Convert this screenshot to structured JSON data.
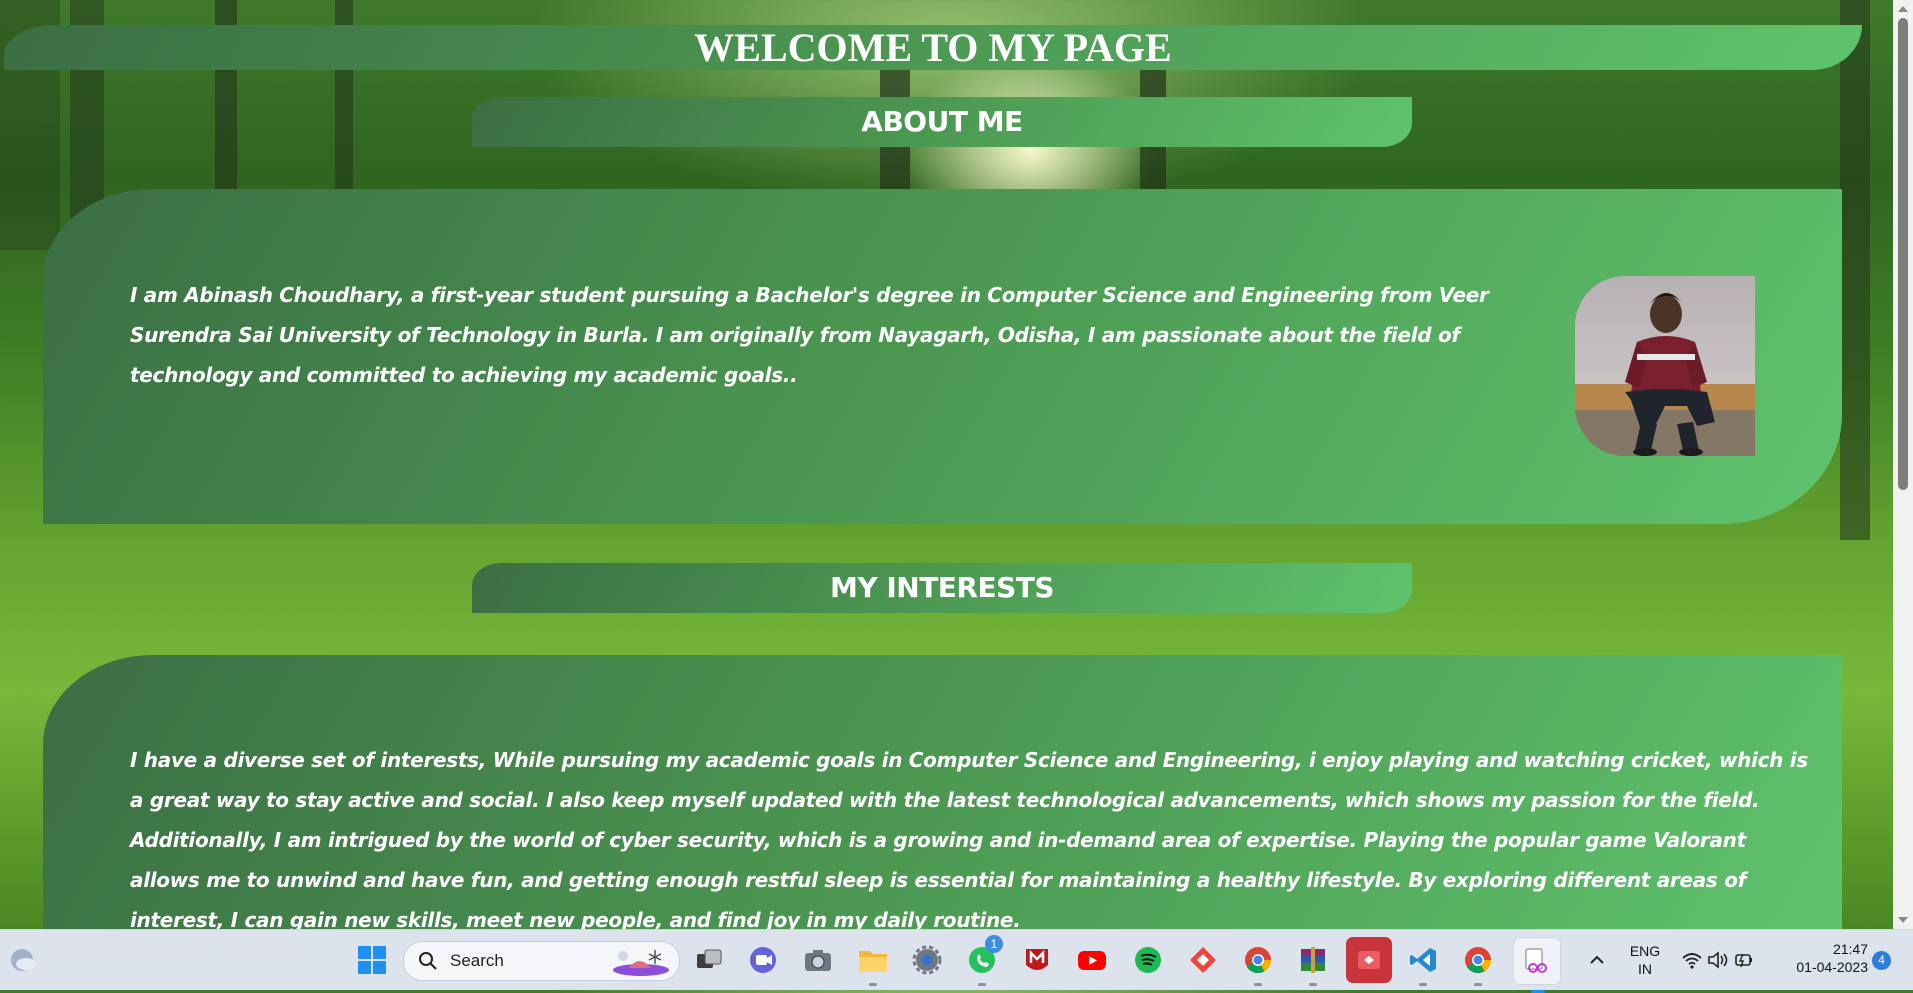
{
  "page": {
    "title": "WELCOME TO MY PAGE",
    "about": {
      "heading": "ABOUT ME",
      "text": "I am Abinash Choudhary, a first-year student pursuing a Bachelor's degree in Computer Science and Engineering from Veer Surendra Sai University of Technology in Burla. I am originally from Nayagarh, Odisha, I am passionate about the field of technology and committed to achieving my academic goals.."
    },
    "interests": {
      "heading": "MY INTERESTS",
      "text": "I have a diverse set of interests, While pursuing my academic goals in Computer Science and Engineering, i enjoy playing and watching cricket, which is a great way to stay active and social. I also keep myself updated with the latest technological advancements, which shows my passion for the field. Additionally, I am intrigued by the world of cyber security, which is a growing and in-demand area of expertise. Playing the popular game Valorant allows me to unwind and have fun, and getting enough restful sleep is essential for maintaining a healthy lifestyle. By exploring different areas of interest, I can gain new skills, meet new people, and find joy in my daily routine."
    }
  },
  "taskbar": {
    "search_label": "Search",
    "language_top": "ENG",
    "language_bottom": "IN",
    "time": "21:47",
    "date": "01-04-2023",
    "notification_count": "4",
    "whatsapp_badge": "1",
    "icons": [
      "weather-icon",
      "windows-start-icon",
      "search-icon",
      "task-view-icon",
      "teams-chat-icon",
      "camera-icon",
      "file-explorer-icon",
      "settings-icon",
      "whatsapp-icon",
      "mcafee-icon",
      "youtube-icon",
      "spotify-icon",
      "anydesk-icon",
      "chrome-icon",
      "winrar-icon",
      "remote-app-icon",
      "vscode-icon",
      "chrome-icon",
      "snipping-tool-icon",
      "chevron-up-icon",
      "wifi-icon",
      "volume-icon",
      "battery-icon"
    ]
  },
  "colors": {
    "card_gradient_start": "#3b6e44",
    "card_gradient_end": "#5fc36d",
    "text": "#ffffff",
    "taskbar_bg": "#dde3ec"
  }
}
